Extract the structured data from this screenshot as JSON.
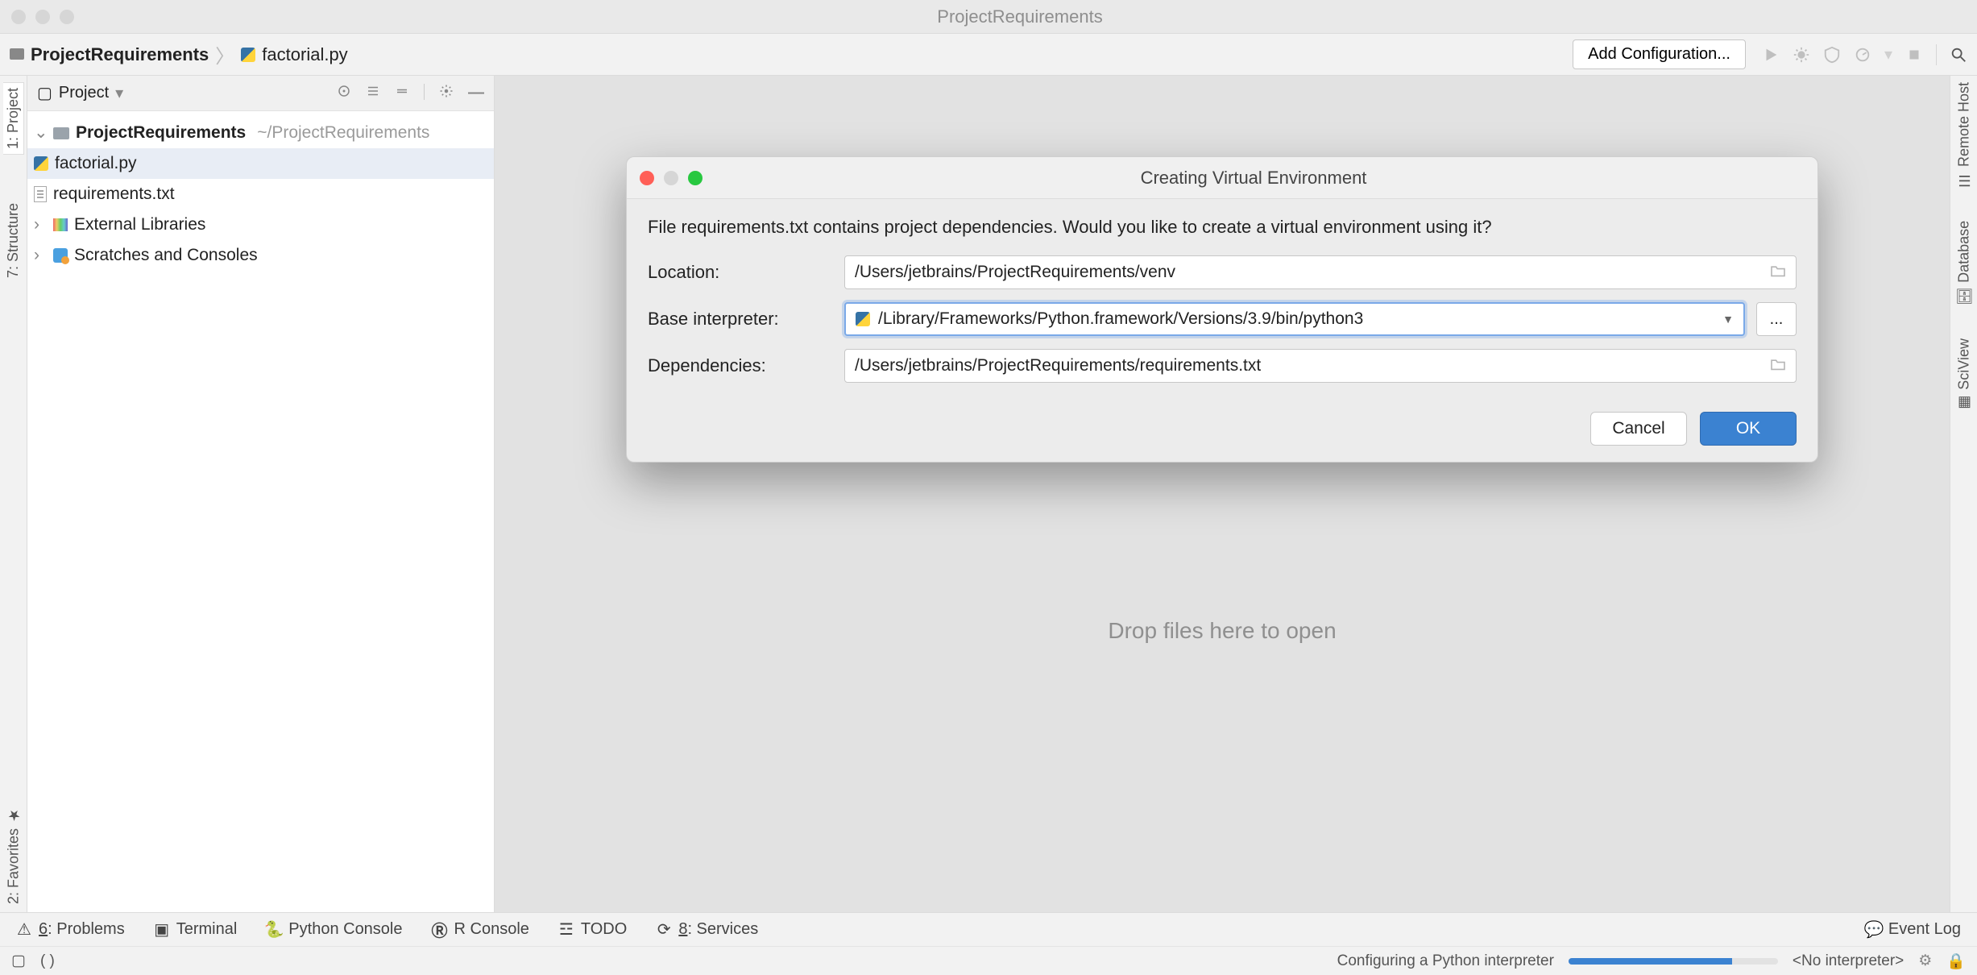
{
  "window": {
    "title": "ProjectRequirements"
  },
  "breadcrumbs": {
    "root": "ProjectRequirements",
    "file": "factorial.py"
  },
  "toolbar": {
    "add_config": "Add Configuration..."
  },
  "sidebar_left": {
    "tab_project": "1: Project",
    "tab_structure": "7: Structure",
    "tab_favorites": "2: Favorites"
  },
  "sidebar_right": {
    "tab_remote": "Remote Host",
    "tab_database": "Database",
    "tab_sciview": "SciView"
  },
  "project_header": {
    "label": "Project"
  },
  "tree": {
    "root": "ProjectRequirements",
    "root_path": "~/ProjectRequirements",
    "file_py": "factorial.py",
    "file_req": "requirements.txt",
    "ext_libs": "External Libraries",
    "scratches": "Scratches and Consoles"
  },
  "editor": {
    "drop_hint": "Drop files here to open"
  },
  "dialog": {
    "title": "Creating Virtual Environment",
    "message": "File requirements.txt contains project dependencies. Would you like to create a virtual environment using it?",
    "location_label": "Location:",
    "location_value": "/Users/jetbrains/ProjectRequirements/venv",
    "interpreter_label": "Base interpreter:",
    "interpreter_value": "/Library/Frameworks/Python.framework/Versions/3.9/bin/python3",
    "dependencies_label": "Dependencies:",
    "dependencies_value": "/Users/jetbrains/ProjectRequirements/requirements.txt",
    "ellipsis": "...",
    "cancel": "Cancel",
    "ok": "OK"
  },
  "bottom": {
    "problems_num": "6",
    "problems": ": Problems",
    "terminal": "Terminal",
    "py_console": "Python Console",
    "r_console": "R Console",
    "todo": "TODO",
    "services_num": "8",
    "services": ": Services",
    "event_log": "Event Log"
  },
  "status": {
    "task": "Configuring a Python interpreter",
    "interpreter": "<No interpreter>"
  }
}
